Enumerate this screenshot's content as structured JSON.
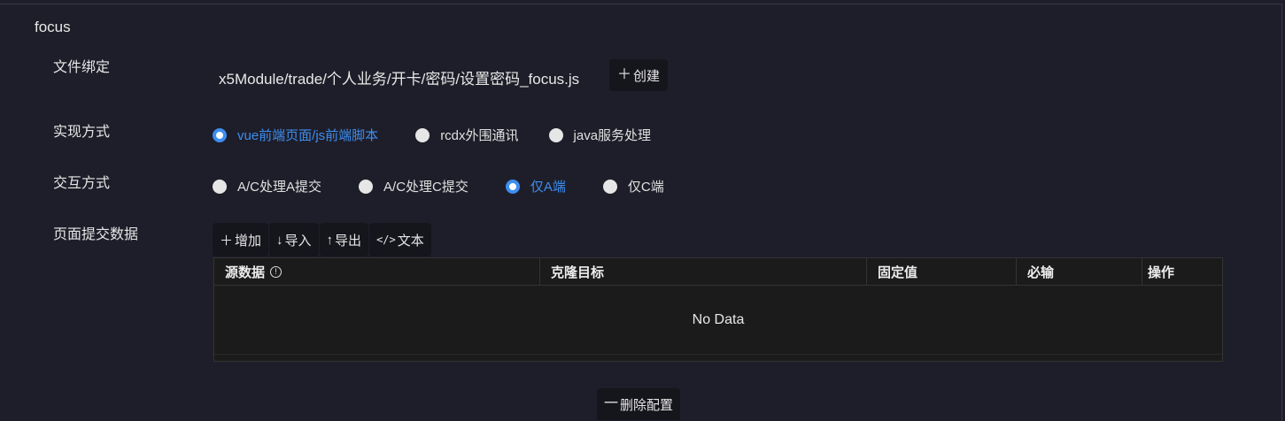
{
  "section": {
    "title": "focus"
  },
  "file_binding": {
    "label": "文件绑定",
    "path": "x5Module/trade/个人业务/开卡/密码/设置密码_focus.js",
    "create_label": "创建"
  },
  "implementation": {
    "label": "实现方式",
    "options": [
      {
        "label": "vue前端页面/js前端脚本",
        "checked": true
      },
      {
        "label": "rcdx外围通讯",
        "checked": false
      },
      {
        "label": "java服务处理",
        "checked": false
      }
    ]
  },
  "interaction": {
    "label": "交互方式",
    "options": [
      {
        "label": "A/C处理A提交",
        "checked": false
      },
      {
        "label": "A/C处理C提交",
        "checked": false
      },
      {
        "label": "仅A端",
        "checked": true
      },
      {
        "label": "仅C端",
        "checked": false
      }
    ]
  },
  "submit_data": {
    "label": "页面提交数据",
    "toolbar": {
      "add_label": "增加",
      "import_label": "导入",
      "export_label": "导出",
      "text_label": "文本"
    },
    "table": {
      "columns": [
        "源数据",
        "克隆目标",
        "固定值",
        "必输",
        "操作"
      ],
      "empty_text": "No Data"
    }
  },
  "footer": {
    "delete_label": "删除配置"
  },
  "icons": {
    "plus": "plus-icon",
    "arrow_down": "arrow-down-icon",
    "arrow_up": "arrow-up-icon",
    "code": "code-icon",
    "info": "info-icon",
    "minus": "minus-icon"
  },
  "colors": {
    "accent": "#3d8ef0",
    "background": "#1e1e2a"
  }
}
